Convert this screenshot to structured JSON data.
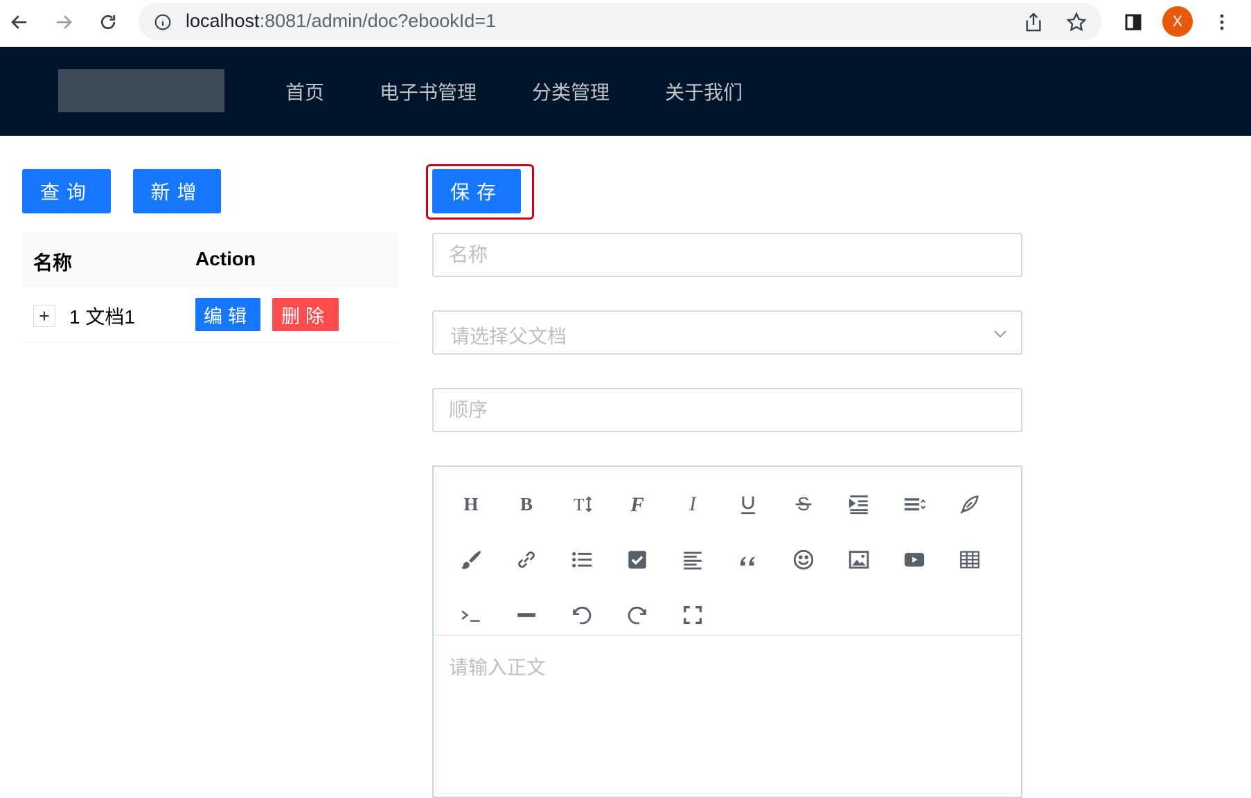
{
  "browser": {
    "url_host": "localhost",
    "url_rest": ":8081/admin/doc?ebookId=1",
    "profile_initial": "X"
  },
  "header": {
    "menu": [
      "首页",
      "电子书管理",
      "分类管理",
      "关于我们"
    ]
  },
  "left": {
    "query_label": "查询",
    "add_label": "新增",
    "table": {
      "columns": [
        "名称",
        "Action"
      ],
      "rows": [
        {
          "expand": "+",
          "name": "1 文档1",
          "edit_label": "编辑",
          "delete_label": "删除"
        }
      ]
    }
  },
  "form": {
    "save_label": "保存",
    "name_placeholder": "名称",
    "parent_placeholder": "请选择父文档",
    "order_placeholder": "顺序",
    "content_placeholder": "请输入正文"
  },
  "editor_toolbar": [
    "heading-icon",
    "bold-icon",
    "font-size-icon",
    "font-family-icon",
    "italic-icon",
    "underline-icon",
    "strikethrough-icon",
    "indent-icon",
    "line-height-icon",
    "highlight-icon",
    "brush-icon",
    "link-icon",
    "unordered-list-icon",
    "checklist-icon",
    "align-left-icon",
    "quote-icon",
    "emoji-icon",
    "image-icon",
    "video-icon",
    "table-icon",
    "code-icon",
    "horizontal-rule-icon",
    "undo-icon",
    "redo-icon",
    "fullscreen-icon"
  ],
  "colors": {
    "primary": "#1677ff",
    "danger": "#ff4d4f",
    "header_bg": "#001529",
    "highlight": "#d0021b"
  }
}
